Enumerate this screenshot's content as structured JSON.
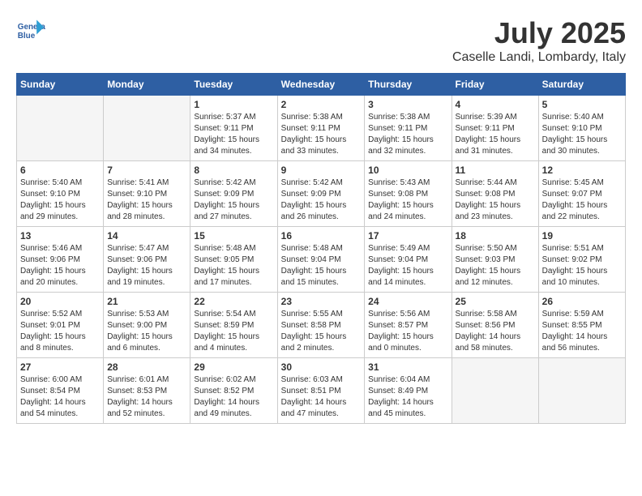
{
  "header": {
    "logo_line1": "General",
    "logo_line2": "Blue",
    "month_title": "July 2025",
    "location": "Caselle Landi, Lombardy, Italy"
  },
  "weekdays": [
    "Sunday",
    "Monday",
    "Tuesday",
    "Wednesday",
    "Thursday",
    "Friday",
    "Saturday"
  ],
  "weeks": [
    [
      {
        "day": "",
        "info": ""
      },
      {
        "day": "",
        "info": ""
      },
      {
        "day": "1",
        "info": "Sunrise: 5:37 AM\nSunset: 9:11 PM\nDaylight: 15 hours and 34 minutes."
      },
      {
        "day": "2",
        "info": "Sunrise: 5:38 AM\nSunset: 9:11 PM\nDaylight: 15 hours and 33 minutes."
      },
      {
        "day": "3",
        "info": "Sunrise: 5:38 AM\nSunset: 9:11 PM\nDaylight: 15 hours and 32 minutes."
      },
      {
        "day": "4",
        "info": "Sunrise: 5:39 AM\nSunset: 9:11 PM\nDaylight: 15 hours and 31 minutes."
      },
      {
        "day": "5",
        "info": "Sunrise: 5:40 AM\nSunset: 9:10 PM\nDaylight: 15 hours and 30 minutes."
      }
    ],
    [
      {
        "day": "6",
        "info": "Sunrise: 5:40 AM\nSunset: 9:10 PM\nDaylight: 15 hours and 29 minutes."
      },
      {
        "day": "7",
        "info": "Sunrise: 5:41 AM\nSunset: 9:10 PM\nDaylight: 15 hours and 28 minutes."
      },
      {
        "day": "8",
        "info": "Sunrise: 5:42 AM\nSunset: 9:09 PM\nDaylight: 15 hours and 27 minutes."
      },
      {
        "day": "9",
        "info": "Sunrise: 5:42 AM\nSunset: 9:09 PM\nDaylight: 15 hours and 26 minutes."
      },
      {
        "day": "10",
        "info": "Sunrise: 5:43 AM\nSunset: 9:08 PM\nDaylight: 15 hours and 24 minutes."
      },
      {
        "day": "11",
        "info": "Sunrise: 5:44 AM\nSunset: 9:08 PM\nDaylight: 15 hours and 23 minutes."
      },
      {
        "day": "12",
        "info": "Sunrise: 5:45 AM\nSunset: 9:07 PM\nDaylight: 15 hours and 22 minutes."
      }
    ],
    [
      {
        "day": "13",
        "info": "Sunrise: 5:46 AM\nSunset: 9:06 PM\nDaylight: 15 hours and 20 minutes."
      },
      {
        "day": "14",
        "info": "Sunrise: 5:47 AM\nSunset: 9:06 PM\nDaylight: 15 hours and 19 minutes."
      },
      {
        "day": "15",
        "info": "Sunrise: 5:48 AM\nSunset: 9:05 PM\nDaylight: 15 hours and 17 minutes."
      },
      {
        "day": "16",
        "info": "Sunrise: 5:48 AM\nSunset: 9:04 PM\nDaylight: 15 hours and 15 minutes."
      },
      {
        "day": "17",
        "info": "Sunrise: 5:49 AM\nSunset: 9:04 PM\nDaylight: 15 hours and 14 minutes."
      },
      {
        "day": "18",
        "info": "Sunrise: 5:50 AM\nSunset: 9:03 PM\nDaylight: 15 hours and 12 minutes."
      },
      {
        "day": "19",
        "info": "Sunrise: 5:51 AM\nSunset: 9:02 PM\nDaylight: 15 hours and 10 minutes."
      }
    ],
    [
      {
        "day": "20",
        "info": "Sunrise: 5:52 AM\nSunset: 9:01 PM\nDaylight: 15 hours and 8 minutes."
      },
      {
        "day": "21",
        "info": "Sunrise: 5:53 AM\nSunset: 9:00 PM\nDaylight: 15 hours and 6 minutes."
      },
      {
        "day": "22",
        "info": "Sunrise: 5:54 AM\nSunset: 8:59 PM\nDaylight: 15 hours and 4 minutes."
      },
      {
        "day": "23",
        "info": "Sunrise: 5:55 AM\nSunset: 8:58 PM\nDaylight: 15 hours and 2 minutes."
      },
      {
        "day": "24",
        "info": "Sunrise: 5:56 AM\nSunset: 8:57 PM\nDaylight: 15 hours and 0 minutes."
      },
      {
        "day": "25",
        "info": "Sunrise: 5:58 AM\nSunset: 8:56 PM\nDaylight: 14 hours and 58 minutes."
      },
      {
        "day": "26",
        "info": "Sunrise: 5:59 AM\nSunset: 8:55 PM\nDaylight: 14 hours and 56 minutes."
      }
    ],
    [
      {
        "day": "27",
        "info": "Sunrise: 6:00 AM\nSunset: 8:54 PM\nDaylight: 14 hours and 54 minutes."
      },
      {
        "day": "28",
        "info": "Sunrise: 6:01 AM\nSunset: 8:53 PM\nDaylight: 14 hours and 52 minutes."
      },
      {
        "day": "29",
        "info": "Sunrise: 6:02 AM\nSunset: 8:52 PM\nDaylight: 14 hours and 49 minutes."
      },
      {
        "day": "30",
        "info": "Sunrise: 6:03 AM\nSunset: 8:51 PM\nDaylight: 14 hours and 47 minutes."
      },
      {
        "day": "31",
        "info": "Sunrise: 6:04 AM\nSunset: 8:49 PM\nDaylight: 14 hours and 45 minutes."
      },
      {
        "day": "",
        "info": ""
      },
      {
        "day": "",
        "info": ""
      }
    ]
  ]
}
